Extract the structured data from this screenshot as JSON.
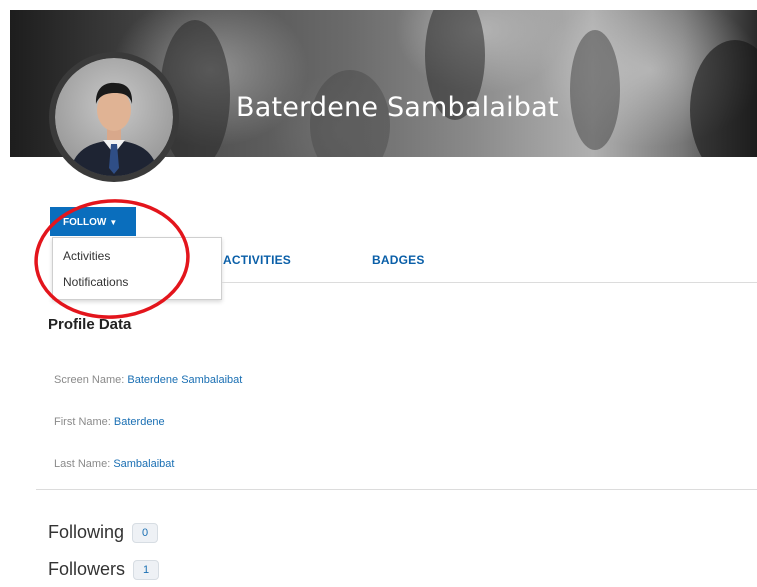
{
  "header": {
    "profile_name": "Baterdene Sambalaibat"
  },
  "follow": {
    "label": "FOLLOW",
    "caret_icon": "caret-down-icon",
    "menu": [
      {
        "label": "Activities"
      },
      {
        "label": "Notifications"
      }
    ]
  },
  "tabs": [
    {
      "label": "ACTIVITIES"
    },
    {
      "label": "BADGES"
    }
  ],
  "profile": {
    "title": "Profile Data",
    "fields": [
      {
        "label": "Screen Name:",
        "value": "Baterdene Sambalaibat"
      },
      {
        "label": "First Name:",
        "value": "Baterdene"
      },
      {
        "label": "Last Name:",
        "value": "Sambalaibat"
      }
    ]
  },
  "stats": [
    {
      "label": "Following",
      "count": "0"
    },
    {
      "label": "Followers",
      "count": "1"
    }
  ],
  "colors": {
    "accent": "#0a6ebd",
    "link": "#1a6fb3",
    "annotation": "#e3151c"
  }
}
